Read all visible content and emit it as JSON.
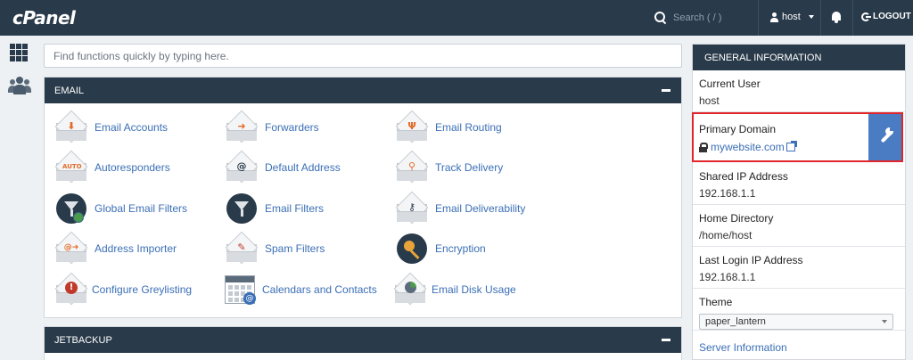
{
  "topbar": {
    "logo": "cPanel",
    "search_placeholder": "Search ( / )",
    "user": "host",
    "logout": "LOGOUT"
  },
  "main": {
    "search_placeholder": "Find functions quickly by typing here.",
    "email_section": {
      "title": "EMAIL",
      "items": [
        {
          "label": "Email Accounts",
          "icon": "email-accounts-icon"
        },
        {
          "label": "Forwarders",
          "icon": "forwarders-icon"
        },
        {
          "label": "Email Routing",
          "icon": "email-routing-icon"
        },
        {
          "label": "Autoresponders",
          "icon": "autoresponders-icon"
        },
        {
          "label": "Default Address",
          "icon": "default-address-icon"
        },
        {
          "label": "Track Delivery",
          "icon": "track-delivery-icon"
        },
        {
          "label": "Global Email Filters",
          "icon": "global-email-filters-icon"
        },
        {
          "label": "Email Filters",
          "icon": "email-filters-icon"
        },
        {
          "label": "Email Deliverability",
          "icon": "email-deliverability-icon"
        },
        {
          "label": "Address Importer",
          "icon": "address-importer-icon"
        },
        {
          "label": "Spam Filters",
          "icon": "spam-filters-icon"
        },
        {
          "label": "Encryption",
          "icon": "encryption-icon"
        },
        {
          "label": "Configure Greylisting",
          "icon": "configure-greylisting-icon"
        },
        {
          "label": "Calendars and Contacts",
          "icon": "calendars-contacts-icon"
        },
        {
          "label": "Email Disk Usage",
          "icon": "email-disk-usage-icon"
        }
      ],
      "icon_marks": {
        "autoresponders": "AUTO",
        "default_address": "@",
        "address_importer": "@➜",
        "calendar_at": "@"
      }
    },
    "jetbackup_section": {
      "title": "JETBACKUP"
    }
  },
  "sidebar": {
    "title": "GENERAL INFORMATION",
    "current_user": {
      "label": "Current User",
      "value": "host"
    },
    "primary_domain": {
      "label": "Primary Domain",
      "value": "mywebsite.com"
    },
    "shared_ip": {
      "label": "Shared IP Address",
      "value": "192.168.1.1"
    },
    "home_directory": {
      "label": "Home Directory",
      "value": "/home/host"
    },
    "last_login_ip": {
      "label": "Last Login IP Address",
      "value": "192.168.1.1"
    },
    "theme": {
      "label": "Theme",
      "value": "paper_lantern"
    },
    "server_information": "Server Information"
  },
  "colors": {
    "topbar": "#293a4a",
    "link": "#3b6fb6",
    "accent_orange": "#e36c2a",
    "highlight_red": "#e0252b",
    "wrench_tile": "#4a7cc4"
  }
}
